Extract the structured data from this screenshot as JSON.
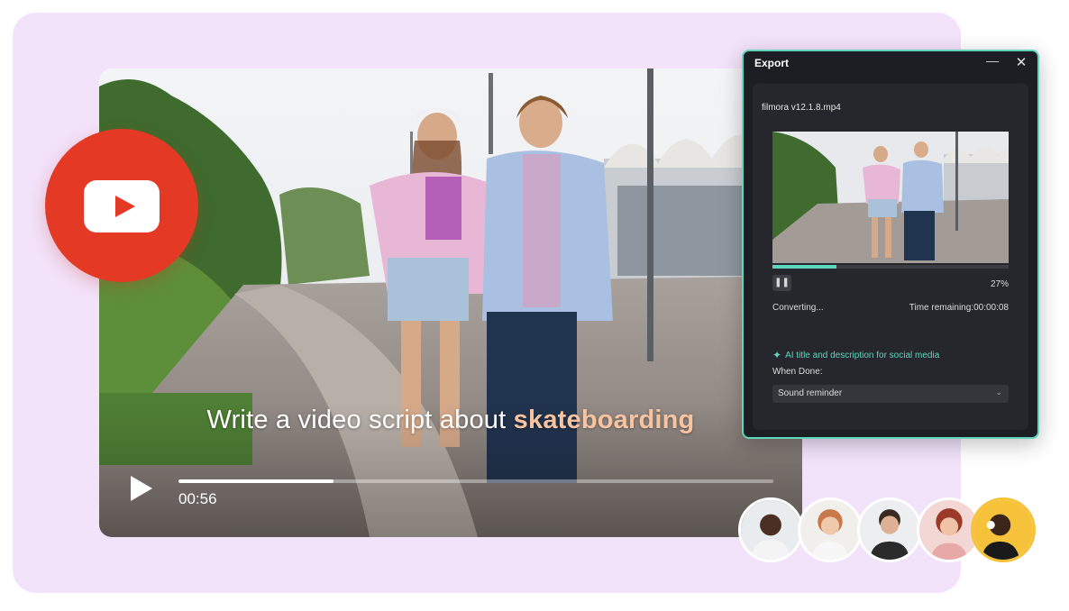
{
  "video": {
    "caption_prefix": "Write a video script about ",
    "caption_highlight": "skateboarding",
    "elapsed_time": "00:56",
    "progress_fraction": 0.26
  },
  "youtube_badge": {
    "icon": "youtube-icon",
    "color": "#e43a25"
  },
  "export_dialog": {
    "title": "Export",
    "minimize_icon": "minimize-icon",
    "close_icon": "close-icon",
    "filename": "filmora v12.1.8.mp4",
    "progress_percent_label": "27%",
    "progress_fraction": 0.27,
    "status_text": "Converting...",
    "time_remaining": "Time remaining:00:00:08",
    "ai_link_label": "AI title and description for social media",
    "when_done_label": "When Done:",
    "when_done_value": "Sound reminder",
    "accent_color": "#5fd6bb"
  },
  "avatars": [
    {
      "name": "avatar-1"
    },
    {
      "name": "avatar-2"
    },
    {
      "name": "avatar-3"
    },
    {
      "name": "avatar-4"
    },
    {
      "name": "avatar-5"
    }
  ]
}
